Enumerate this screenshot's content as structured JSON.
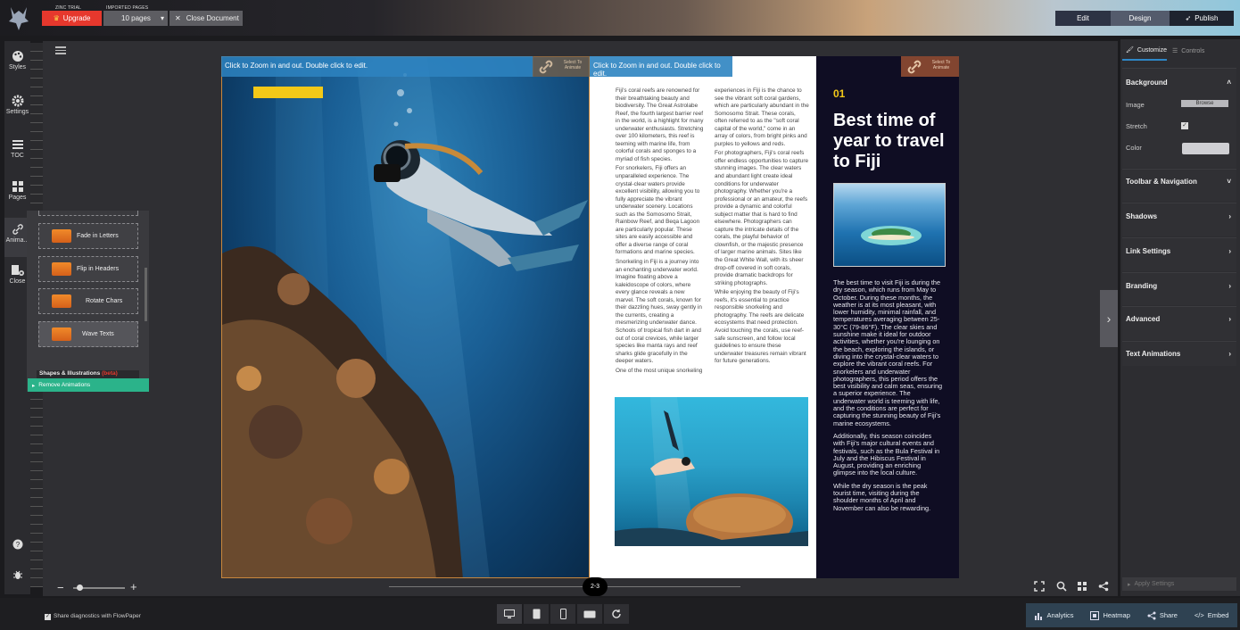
{
  "topbar": {
    "trial_label": "ZINC TRIAL",
    "upgrade_label": "Upgrade",
    "imported_pages_label": "IMPORTED PAGES",
    "pages_value": "10 pages",
    "close_document_label": "Close Document",
    "edit_label": "Edit",
    "design_label": "Design",
    "publish_label": "Publish"
  },
  "leftbar": {
    "items": [
      {
        "label": "Styles",
        "icon": "palette-icon"
      },
      {
        "label": "Settings",
        "icon": "gear-icon"
      },
      {
        "label": "TOC",
        "icon": "list-icon"
      },
      {
        "label": "Pages",
        "icon": "grid-icon"
      },
      {
        "label": "Anima...",
        "icon": "link-icon"
      },
      {
        "label": "Close",
        "icon": "close-panel-icon"
      }
    ],
    "bottom_icons": [
      "help-icon",
      "bug-icon"
    ]
  },
  "animations_panel": {
    "items": [
      {
        "label": "Fade in Letters"
      },
      {
        "label": "Flip in Headers"
      },
      {
        "label": "Rotate Chars"
      },
      {
        "label": "Wave Texts"
      }
    ],
    "shapes_label": "Shapes & Illustrations",
    "shapes_badge": "(beta)",
    "remove_label": "Remove Animations"
  },
  "canvas": {
    "zoom_hint": "Click to Zoom in and out. Double click to edit.",
    "select_animate_label": "Select To Animate",
    "page_indicator": "2-3"
  },
  "article": {
    "col1": [
      "Fiji's coral reefs are renowned for their breathtaking beauty and biodiversity. The Great Astrolabe Reef, the fourth largest barrier reef in the world, is a highlight for many underwater enthusiasts. Stretching over 100 kilometers, this reef is teeming with marine life, from colorful corals and sponges to a myriad of fish species.",
      "For snorkelers, Fiji offers an unparalleled experience. The crystal-clear waters provide excellent visibility, allowing you to fully appreciate the vibrant underwater scenery. Locations such as the Somosomo Strait, Rainbow Reef, and Beqa Lagoon are particularly popular. These sites are easily accessible and offer a diverse range of coral formations and marine species.",
      "Snorkeling in Fiji is a journey into an enchanting underwater world. Imagine floating above a kaleidoscope of colors, where every glance reveals a new marvel. The soft corals, known for their dazzling hues, sway gently in the currents, creating a mesmerizing underwater dance. Schools of tropical fish dart in and out of coral crevices, while larger species like manta rays and reef sharks glide gracefully in the deeper waters.",
      "One of the most unique snorkeling"
    ],
    "col2": [
      "experiences in Fiji is the chance to see the vibrant soft coral gardens, which are particularly abundant in the Somosomo Strait. These corals, often referred to as the \"soft coral capital of the world,\" come in an array of colors, from bright pinks and purples to yellows and reds.",
      "For photographers, Fiji's coral reefs offer endless opportunities to capture stunning images. The clear waters and abundant light create ideal conditions for underwater photography. Whether you're a professional or an amateur, the reefs provide a dynamic and colorful subject matter that is hard to find elsewhere. Photographers can capture the intricate details of the corals, the playful behavior of clownfish, or the majestic presence of larger marine animals. Sites like the Great White Wall, with its sheer drop-off covered in soft corals, provide dramatic backdrops for striking photographs.",
      "While enjoying the beauty of Fiji's reefs, it's essential to practice responsible snorkeling and photography. The reefs are delicate ecosystems that need protection. Avoid touching the corals, use reef-safe sunscreen, and follow local guidelines to ensure these underwater treasures remain vibrant for future generations."
    ]
  },
  "right_page": {
    "number": "01",
    "heading": "Best time of year to travel to Fiji",
    "paragraphs": [
      "The best time to visit Fiji is during the dry season, which runs from May to October. During these months, the weather is at its most pleasant, with lower humidity, minimal rainfall, and temperatures averaging between 25-30°C (79-86°F). The clear skies and sunshine make it ideal for outdoor activities, whether you're lounging on the beach, exploring the islands, or diving into the crystal-clear waters to explore the vibrant coral reefs. For snorkelers and underwater photographers, this period offers the best visibility and calm seas, ensuring a superior experience. The underwater world is teeming with life, and the conditions are perfect for capturing the stunning beauty of Fiji's marine ecosystems.",
      "Additionally, this season coincides with Fiji's major cultural events and festivals, such as the Bula Festival in July and the Hibiscus Festival in August, providing an enriching glimpse into the local culture.",
      "While the dry season is the peak tourist time, visiting during the shoulder months of April and November can also be rewarding."
    ]
  },
  "right_panel": {
    "customize_tab": "Customize",
    "controls_tab": "Controls",
    "background_title": "Background",
    "image_label": "Image",
    "browse_label": "Browse",
    "stretch_label": "Stretch",
    "color_label": "Color",
    "sections": [
      "Toolbar & Navigation",
      "Shadows",
      "Link Settings",
      "Branding",
      "Advanced",
      "Text Animations"
    ],
    "apply_label": "Apply Settings"
  },
  "bottombar": {
    "diagnostics_label": "Share diagnostics with FlowPaper",
    "actions": [
      "Analytics",
      "Heatmap",
      "Share",
      "Embed"
    ]
  },
  "colors": {
    "accent_blue": "#2e87c7",
    "upgrade_red": "#e6382d",
    "remove_green": "#2bb38a",
    "highlight_yellow": "#f3c918",
    "page_dark": "#0f0d23"
  }
}
